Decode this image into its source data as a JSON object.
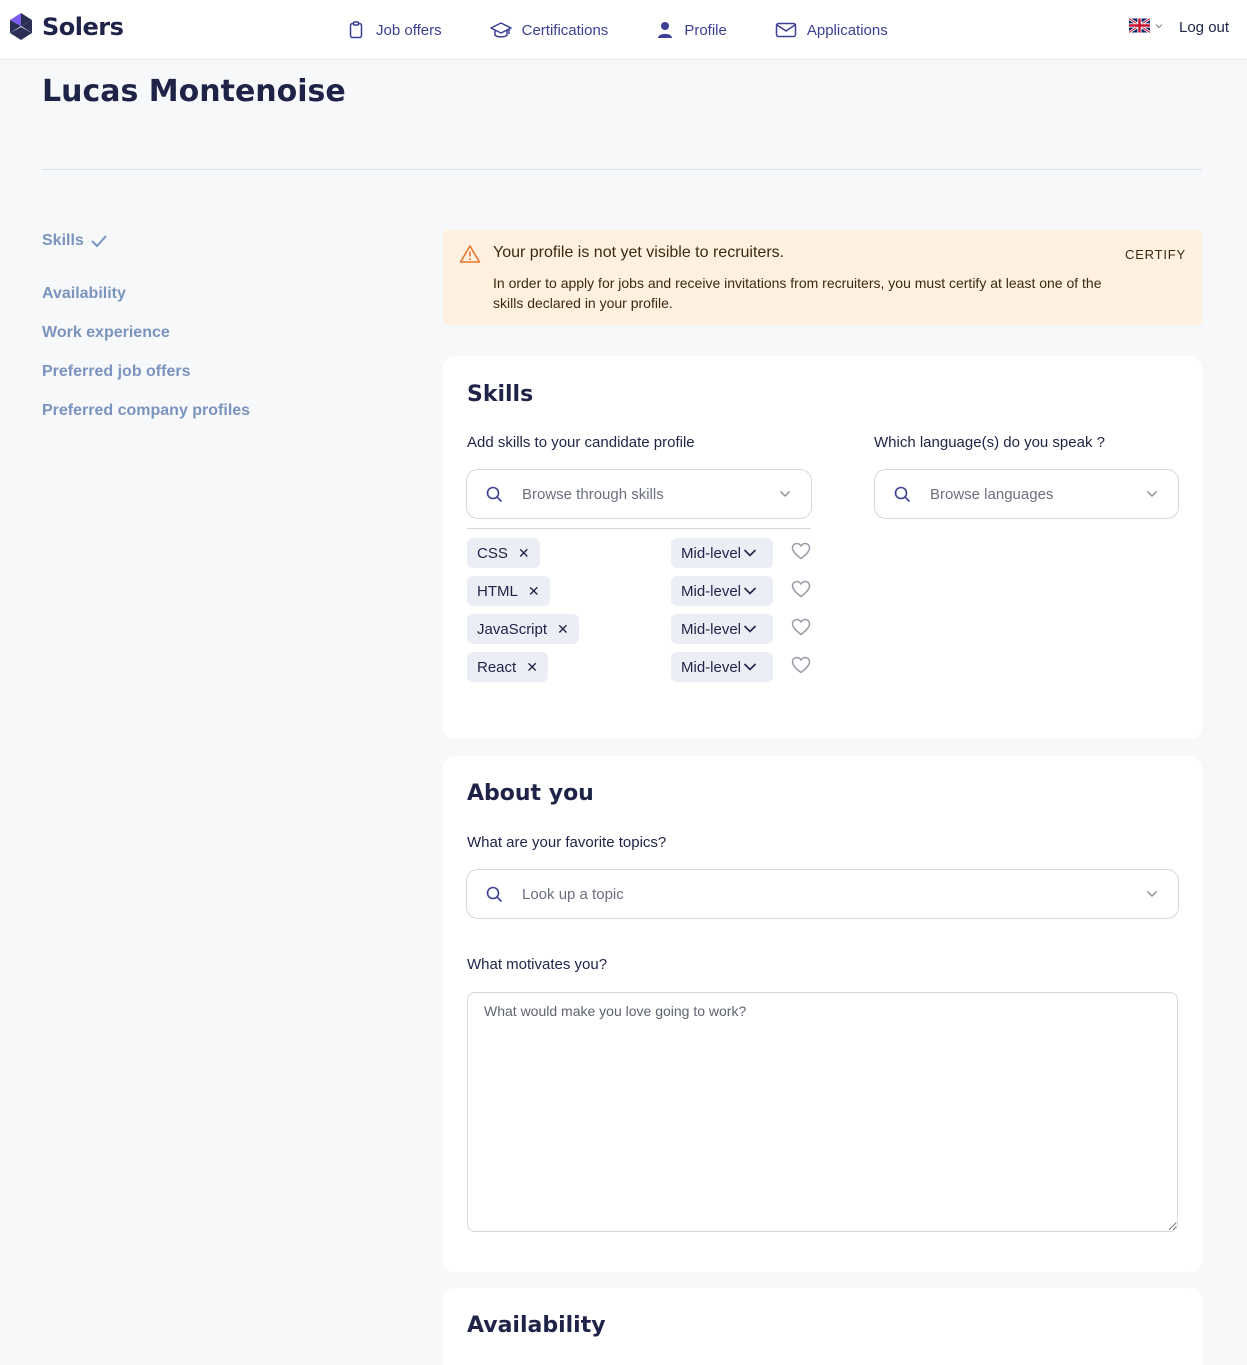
{
  "header": {
    "brand": "Solers",
    "nav": [
      {
        "label": "Job offers",
        "icon": "clipboard-icon"
      },
      {
        "label": "Certifications",
        "icon": "graduation-cap-icon"
      },
      {
        "label": "Profile",
        "icon": "user-icon"
      },
      {
        "label": "Applications",
        "icon": "envelope-icon"
      }
    ],
    "language_icon": "uk-flag-icon",
    "logout": "Log out"
  },
  "page": {
    "title": "Lucas Montenoise"
  },
  "sidebar": {
    "items": [
      {
        "label": "Skills",
        "done": true
      },
      {
        "label": "Availability"
      },
      {
        "label": "Work experience"
      },
      {
        "label": "Preferred job offers"
      },
      {
        "label": "Preferred company profiles"
      }
    ]
  },
  "alert": {
    "title": "Your profile is not yet visible to recruiters.",
    "text": "In order to apply for jobs and receive invitations from recruiters, you must certify at least one of the skills declared in your profile.",
    "action": "CERTIFY",
    "color": "#fff0e0"
  },
  "skills": {
    "title": "Skills",
    "add_label": "Add skills to your candidate profile",
    "skills_placeholder": "Browse through skills",
    "languages_label": "Which language(s) do you speak ?",
    "languages_placeholder": "Browse languages",
    "items": [
      {
        "name": "CSS",
        "level": "Mid-level"
      },
      {
        "name": "HTML",
        "level": "Mid-level"
      },
      {
        "name": "JavaScript",
        "level": "Mid-level"
      },
      {
        "name": "React",
        "level": "Mid-level"
      }
    ]
  },
  "about": {
    "title": "About you",
    "topics_label": "What are your favorite topics?",
    "topics_placeholder": "Look up a topic",
    "motivation_label": "What motivates you?",
    "motivation_placeholder": "What would make you love going to work?"
  },
  "availability": {
    "title": "Availability"
  },
  "colors": {
    "nav": "#3d3f94",
    "heading": "#1e2347",
    "sidebar": "#7b93bf",
    "alert_icon": "#e8762d"
  }
}
